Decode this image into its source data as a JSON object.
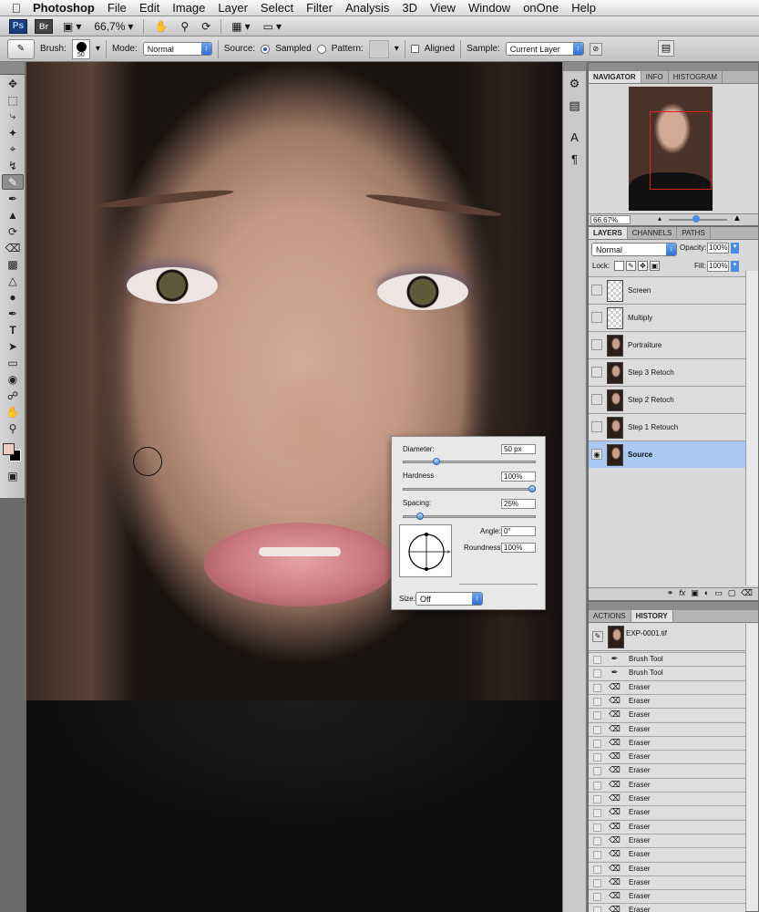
{
  "menubar": {
    "app_name": "Photoshop",
    "items": [
      "File",
      "Edit",
      "Image",
      "Layer",
      "Select",
      "Filter",
      "Analysis",
      "3D",
      "View",
      "Window",
      "onOne",
      "Help"
    ]
  },
  "appbar": {
    "ps_logo": "Ps",
    "br_logo": "Br",
    "zoom": "66,7%"
  },
  "options": {
    "brush_label": "Brush:",
    "brush_size": "50",
    "mode_label": "Mode:",
    "mode_value": "Normal",
    "source_label": "Source:",
    "sampled_label": "Sampled",
    "pattern_label": "Pattern:",
    "aligned_label": "Aligned",
    "sample_label": "Sample:",
    "sample_value": "Current Layer"
  },
  "brush_picker": {
    "diameter_label": "Diameter:",
    "diameter_value": "50 px",
    "hardness_label": "Hardness",
    "hardness_value": "100%",
    "spacing_label": "Spacing:",
    "spacing_value": "25%",
    "angle_label": "Angle:",
    "angle_value": "0°",
    "roundness_label": "Roundness:",
    "roundness_value": "100%",
    "size_label": "Size:",
    "size_value": "Off",
    "diameter_fraction": 0.25,
    "hardness_fraction": 1.0,
    "spacing_fraction": 0.12
  },
  "navigator": {
    "tabs": [
      "NAVIGATOR",
      "INFO",
      "HISTOGRAM"
    ],
    "zoom": "66,67%"
  },
  "layers": {
    "tabs": [
      "LAYERS",
      "CHANNELS",
      "PATHS"
    ],
    "blend_mode": "Normal",
    "opacity_label": "Opacity:",
    "opacity_value": "100%",
    "lock_label": "Lock:",
    "fill_label": "Fill:",
    "fill_value": "100%",
    "items": [
      {
        "name": "Screen",
        "thumb": "blank",
        "selected": false
      },
      {
        "name": "Multiply",
        "thumb": "blank",
        "selected": false
      },
      {
        "name": "Portraiture",
        "thumb": "portrait",
        "selected": false
      },
      {
        "name": "Step 3 Retoch",
        "thumb": "portrait",
        "selected": false
      },
      {
        "name": "Step 2 Retoch",
        "thumb": "portrait",
        "selected": false
      },
      {
        "name": "Step 1 Retouch",
        "thumb": "portrait",
        "selected": false
      },
      {
        "name": "Source",
        "thumb": "portrait",
        "selected": true
      }
    ]
  },
  "history": {
    "tabs": [
      "ACTIONS",
      "HISTORY"
    ],
    "snapshot": "EXP-0001.tif",
    "items": [
      {
        "label": "Brush Tool",
        "icon": "brush-icon"
      },
      {
        "label": "Brush Tool",
        "icon": "brush-icon"
      },
      {
        "label": "Eraser",
        "icon": "eraser-icon"
      },
      {
        "label": "Eraser",
        "icon": "eraser-icon"
      },
      {
        "label": "Eraser",
        "icon": "eraser-icon"
      },
      {
        "label": "Eraser",
        "icon": "eraser-icon"
      },
      {
        "label": "Eraser",
        "icon": "eraser-icon"
      },
      {
        "label": "Eraser",
        "icon": "eraser-icon"
      },
      {
        "label": "Eraser",
        "icon": "eraser-icon"
      },
      {
        "label": "Eraser",
        "icon": "eraser-icon"
      },
      {
        "label": "Eraser",
        "icon": "eraser-icon"
      },
      {
        "label": "Eraser",
        "icon": "eraser-icon"
      },
      {
        "label": "Eraser",
        "icon": "eraser-icon"
      },
      {
        "label": "Eraser",
        "icon": "eraser-icon"
      },
      {
        "label": "Eraser",
        "icon": "eraser-icon"
      },
      {
        "label": "Eraser",
        "icon": "eraser-icon"
      },
      {
        "label": "Eraser",
        "icon": "eraser-icon"
      },
      {
        "label": "Eraser",
        "icon": "eraser-icon"
      },
      {
        "label": "Eraser",
        "icon": "eraser-icon"
      }
    ]
  },
  "colors": {
    "foreground": "#e9cbc0",
    "background": "#000000",
    "selection": "#a9c9f3"
  }
}
